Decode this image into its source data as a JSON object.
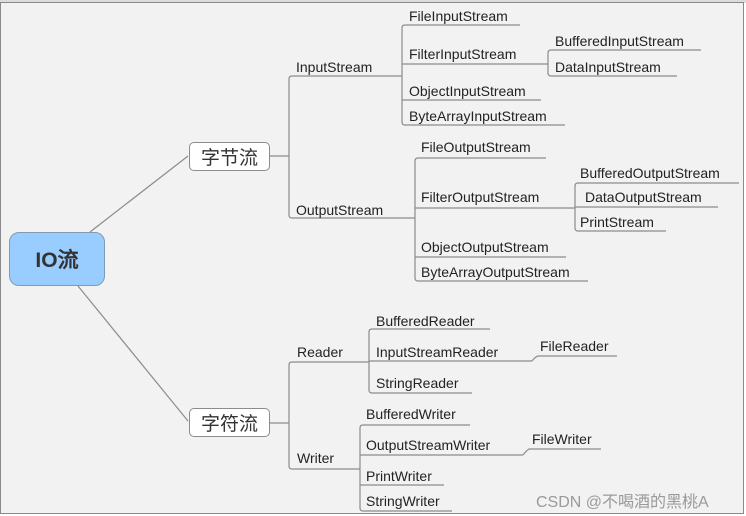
{
  "root": {
    "label": "IO流",
    "color": "#99ccff"
  },
  "branches": {
    "byte": {
      "label": "字节流",
      "input": {
        "label": "InputStream",
        "children": [
          "FileInputStream",
          "FilterInputStream",
          "ObjectInputStream",
          "ByteArrayInputStream"
        ],
        "filter_children": [
          "BufferedInputStream",
          "DataInputStream"
        ]
      },
      "output": {
        "label": "OutputStream",
        "children": [
          "FileOutputStream",
          "FilterOutputStream",
          "ObjectOutputStream",
          "ByteArrayOutputStream"
        ],
        "filter_children": [
          "BufferedOutputStream",
          "DataOutputStream",
          "PrintStream"
        ]
      }
    },
    "char": {
      "label": "字符流",
      "reader": {
        "label": "Reader",
        "children": [
          "BufferedReader",
          "InputStreamReader",
          "StringReader"
        ],
        "isr_children": [
          "FileReader"
        ]
      },
      "writer": {
        "label": "Writer",
        "children": [
          "BufferedWriter",
          "OutputStreamWriter",
          "PrintWriter",
          "StringWriter"
        ],
        "osw_children": [
          "FileWriter"
        ]
      }
    }
  },
  "watermark": "CSDN @不喝酒的黑桃A"
}
